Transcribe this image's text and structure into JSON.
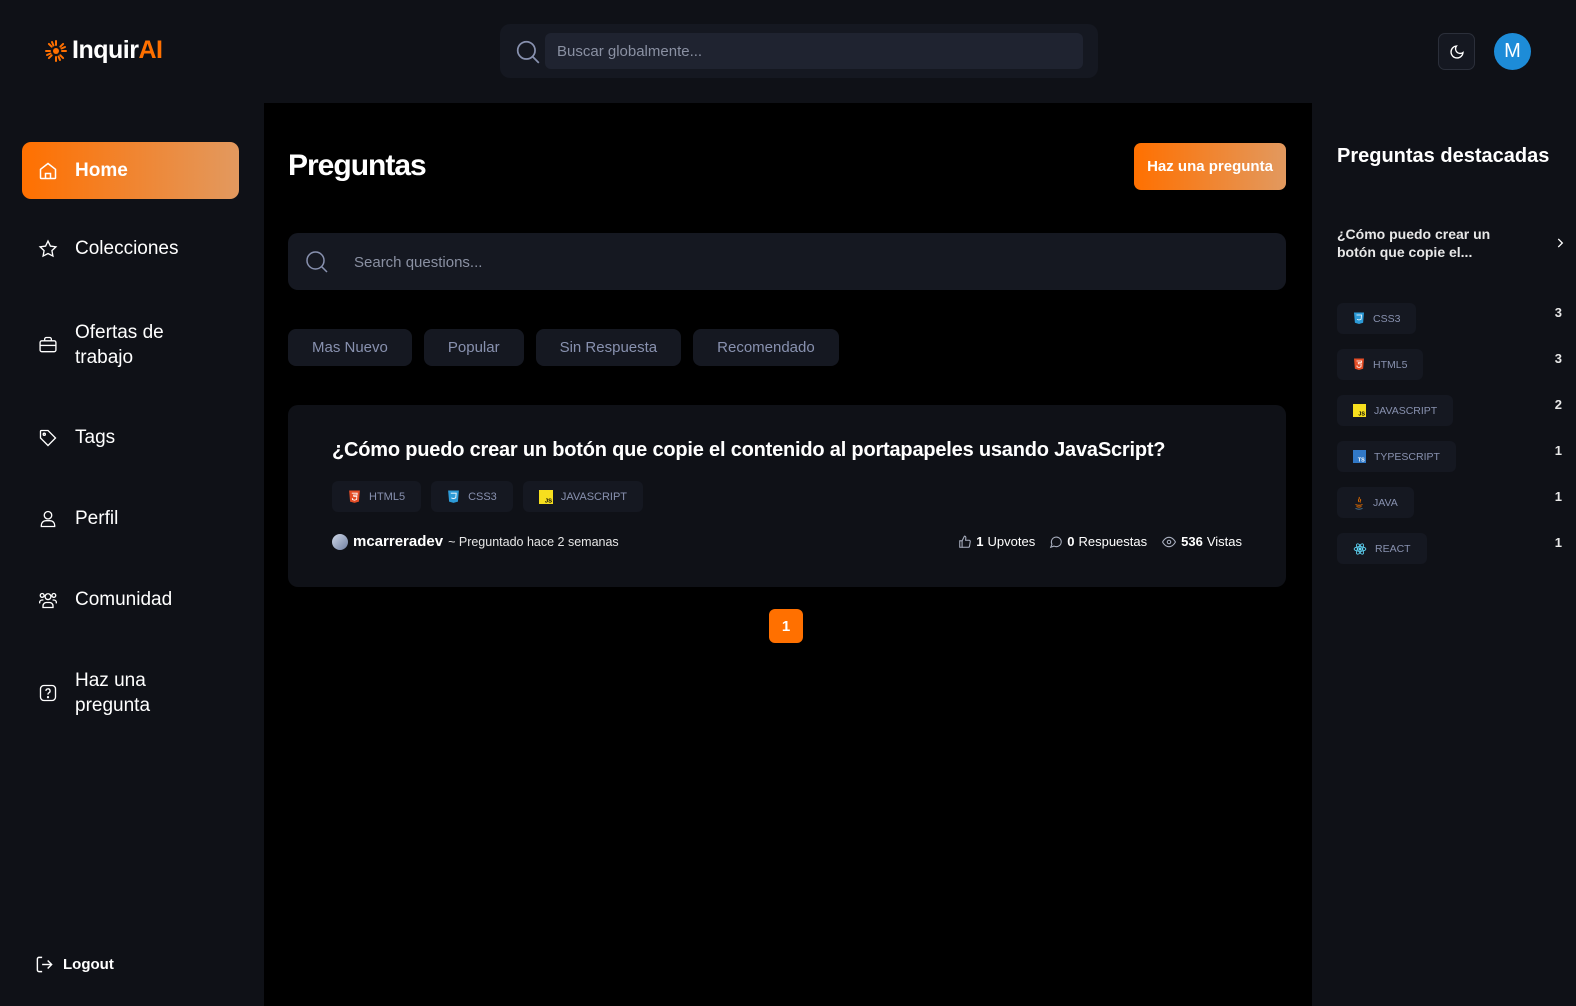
{
  "header": {
    "logo_prefix": "Inquir",
    "logo_suffix": "AI",
    "search_placeholder": "Buscar globalmente...",
    "theme_icon": "moon-icon",
    "avatar_initial": "M",
    "avatar_color": "#1d8cd8"
  },
  "sidebar": {
    "items": [
      {
        "label": "Home",
        "icon": "home-icon",
        "active": true
      },
      {
        "label": "Colecciones",
        "icon": "star-icon"
      },
      {
        "label": "Ofertas de trabajo",
        "icon": "briefcase-icon"
      },
      {
        "label": "Tags",
        "icon": "tag-icon"
      },
      {
        "label": "Perfil",
        "icon": "user-icon"
      },
      {
        "label": "Comunidad",
        "icon": "users-icon"
      },
      {
        "label": "Haz una pregunta",
        "icon": "question-icon"
      }
    ],
    "logout_label": "Logout"
  },
  "main": {
    "title": "Preguntas",
    "ask_button": "Haz una pregunta",
    "search_placeholder": "Search questions...",
    "filters": [
      "Mas Nuevo",
      "Popular",
      "Sin Respuesta",
      "Recomendado"
    ],
    "questions": [
      {
        "title": "¿Cómo puedo crear un botón que copie el contenido al portapapeles usando JavaScript?",
        "tags": [
          "HTML5",
          "CSS3",
          "JAVASCRIPT"
        ],
        "author": "mcarreradev",
        "asked": "~ Preguntado hace 2 semanas",
        "upvotes": "1",
        "upvotes_label": "Upvotes",
        "answers": "0",
        "answers_label": "Respuestas",
        "views": "536",
        "views_label": "Vistas"
      }
    ],
    "page": "1"
  },
  "rightbar": {
    "title": "Preguntas destacadas",
    "hot_questions": [
      "¿Cómo puedo crear un botón que copie el..."
    ],
    "popular_tags": [
      {
        "name": "CSS3",
        "count": "3"
      },
      {
        "name": "HTML5",
        "count": "3"
      },
      {
        "name": "JAVASCRIPT",
        "count": "2"
      },
      {
        "name": "TYPESCRIPT",
        "count": "1"
      },
      {
        "name": "JAVA",
        "count": "1"
      },
      {
        "name": "REACT",
        "count": "1"
      }
    ]
  },
  "colors": {
    "accent": "#ff7000",
    "accent_gradient_end": "#e2995f",
    "panel": "#0f1117",
    "card": "#151821",
    "muted_text": "#8891af"
  }
}
